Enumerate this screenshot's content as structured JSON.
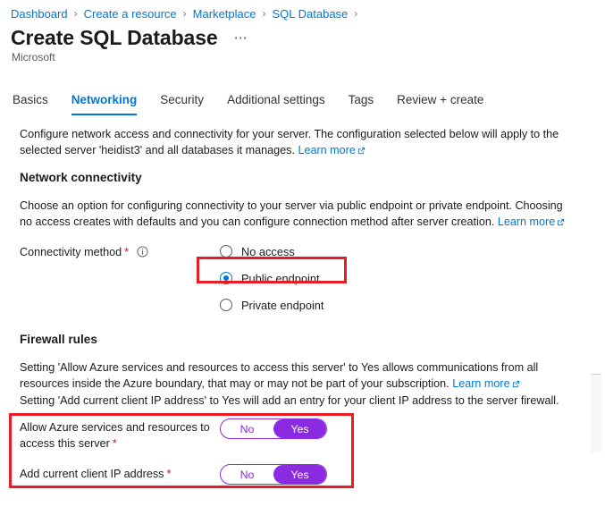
{
  "breadcrumb": {
    "separator": "›",
    "items": [
      {
        "label": "Dashboard"
      },
      {
        "label": "Create a resource"
      },
      {
        "label": "Marketplace"
      },
      {
        "label": "SQL Database"
      }
    ]
  },
  "header": {
    "title": "Create SQL Database",
    "ellipsis": "⋯",
    "publisher": "Microsoft"
  },
  "tabs": [
    {
      "label": "Basics",
      "active": false
    },
    {
      "label": "Networking",
      "active": true
    },
    {
      "label": "Security",
      "active": false
    },
    {
      "label": "Additional settings",
      "active": false
    },
    {
      "label": "Tags",
      "active": false
    },
    {
      "label": "Review + create",
      "active": false
    }
  ],
  "intro": {
    "text": "Configure network access and connectivity for your server. The configuration selected below will apply to the selected server 'heidist3' and all databases it manages.",
    "link_label": "Learn more"
  },
  "network_connectivity": {
    "heading": "Network connectivity",
    "description": "Choose an option for configuring connectivity to your server via public endpoint or private endpoint. Choosing no access creates with defaults and you can configure connection method after server creation.",
    "link_label": "Learn more",
    "connectivity_method": {
      "label": "Connectivity method",
      "required_marker": "*",
      "info_icon": "info-circle-icon",
      "options": [
        {
          "label": "No access",
          "selected": false
        },
        {
          "label": "Public endpoint",
          "selected": true
        },
        {
          "label": "Private endpoint",
          "selected": false
        }
      ],
      "selected_value": "Public endpoint"
    }
  },
  "firewall_rules": {
    "heading": "Firewall rules",
    "description_line1": "Setting 'Allow Azure services and resources to access this server' to Yes allows communications from all resources inside the Azure boundary, that may or may not be part of your subscription.",
    "link_label": "Learn more",
    "description_line2": "Setting 'Add current client IP address' to Yes will add an entry for your client IP address to the server firewall.",
    "toggles": [
      {
        "label": "Allow Azure services and resources to access this server",
        "required_marker": "*",
        "off_label": "No",
        "on_label": "Yes",
        "value": "Yes"
      },
      {
        "label": "Add current client IP address",
        "required_marker": "*",
        "off_label": "No",
        "on_label": "Yes",
        "value": "Yes"
      }
    ]
  },
  "annotations": [
    {
      "name": "public-endpoint-highlight",
      "target": "Public endpoint"
    },
    {
      "name": "firewall-toggles-highlight",
      "target": "Firewall rules toggles"
    }
  ],
  "colors": {
    "link_blue": "#0078d4",
    "accent_purple": "#8a2be2",
    "annotation_red": "#ec1c24",
    "required_red": "#a4262c",
    "text": "#1b1b1b"
  }
}
